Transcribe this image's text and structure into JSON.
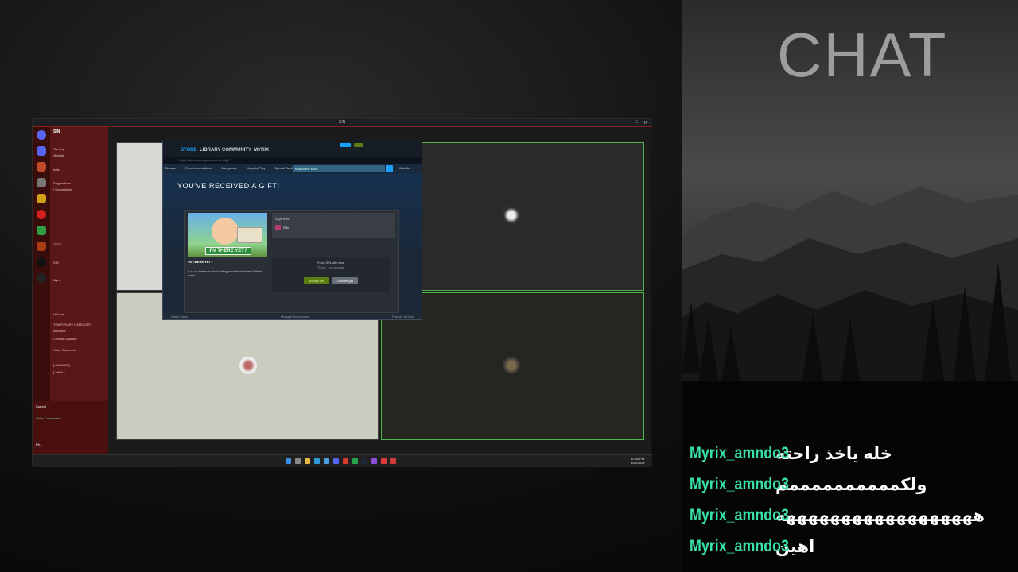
{
  "overlay": {
    "chat_title": "CHAT",
    "messages": [
      {
        "user": "Myrix_amndo3",
        "text": "خله ياخذ راحته"
      },
      {
        "user": "Myrix_amndo3",
        "text": "ولكممممممممممم"
      },
      {
        "user": "Myrix_amndo3",
        "text": "ههههههههههههههههههه"
      },
      {
        "user": "Myrix_amndo3",
        "text": "اهين"
      }
    ],
    "user_color": "#38e0a6"
  },
  "window": {
    "title": "SIN"
  },
  "discord": {
    "server_name": "SIN",
    "channels": [
      "Gaming",
      "@chats",
      "bots",
      "Suggestions",
      "| Suggestions",
      "TEXT",
      "SIN",
      "Myrix",
      "Hull-me",
      "TEMPORARY CATEGORY",
      "Interface",
      "Creator Channel",
      "Voice Channels",
      "[ GAMING ]",
      "[ TalkN ]"
    ],
    "voice_status": "Voice Connected",
    "voice_channel": "Conect",
    "user_name": "Ph..."
  },
  "steam": {
    "tabs": [
      "STORE",
      "LIBRARY",
      "COMMUNITY",
      "MYRIX"
    ],
    "url": "https://store.steampowered.com/gift",
    "menu": [
      "Browse",
      "Recommendations",
      "Categories",
      "Ways to Play",
      "Special Sections"
    ],
    "search_placeholder": "search the store",
    "wishlist": "Wishlist",
    "heading": "YOU'VE RECEIVED A GIFT!",
    "game_banner": "RV THERE YET?",
    "game_name": "RV THERE YET?",
    "game_desc": "A co-op adventure about driving your Reconditioned Vehicle home.",
    "gift_from_label": "A gift from:",
    "sender": "SIN",
    "from_text": "From SIN with love",
    "gift_message": "\"Enjoy\" - no message",
    "accept_label": "Accept gift",
    "decline_label": "Decline gift",
    "footer_left": "Add a Game",
    "footer_mid": "Manage Downloads",
    "footer_right": "Friends & Chat"
  },
  "taskbar": {
    "time": "10:45 PM",
    "date": "11/9/2025"
  }
}
